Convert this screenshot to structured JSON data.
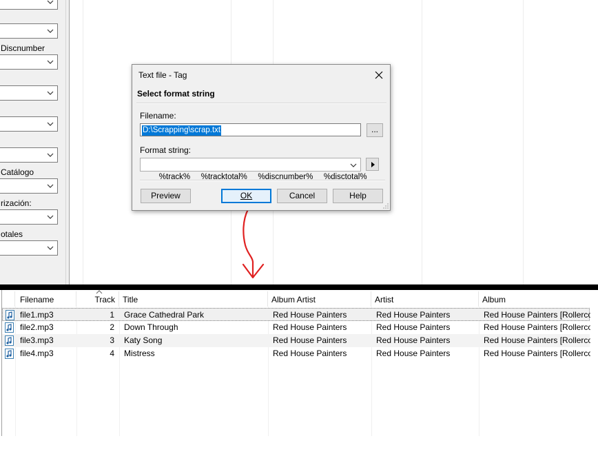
{
  "left_panel": {
    "labels": [
      "Discnumber",
      "Catálogo",
      "rización:",
      "otales"
    ]
  },
  "dialog": {
    "title": "Text file - Tag",
    "subtitle": "Select format string",
    "filename_label": "Filename:",
    "filename_value": "D:\\Scrapping\\scrap.txt",
    "browse_label": "...",
    "format_label": "Format string:",
    "format_value": "%track%   %tracktotal%   %discnumber%   %disctotal%",
    "buttons": {
      "preview": "Preview",
      "ok": "OK",
      "cancel": "Cancel",
      "help": "Help"
    }
  },
  "file_list": {
    "columns": [
      "Filename",
      "Track",
      "Title",
      "Album Artist",
      "Artist",
      "Album"
    ],
    "rows": [
      {
        "filename": "file1.mp3",
        "track": "1",
        "title": "Grace Cathedral Park",
        "album_artist": "Red House Painters",
        "artist": "Red House Painters",
        "album": "Red House Painters [Rollerco..."
      },
      {
        "filename": "file2.mp3",
        "track": "2",
        "title": "Down Through",
        "album_artist": "Red House Painters",
        "artist": "Red House Painters",
        "album": "Red House Painters [Rollerco..."
      },
      {
        "filename": "file3.mp3",
        "track": "3",
        "title": "Katy Song",
        "album_artist": "Red House Painters",
        "artist": "Red House Painters",
        "album": "Red House Painters [Rollerco..."
      },
      {
        "filename": "file4.mp3",
        "track": "4",
        "title": "Mistress",
        "album_artist": "Red House Painters",
        "artist": "Red House Painters",
        "album": "Red House Painters [Rollerco..."
      }
    ]
  },
  "icons": {
    "close": "close-icon",
    "dropdown": "chevron-down-icon",
    "arrow": "chevron-right-icon",
    "file": "audio-file-icon",
    "sort": "sort-up-icon",
    "annotation": "hand-drawn-arrow"
  },
  "colors": {
    "selection": "#0078d7",
    "ok_border": "#0078d7",
    "annotation": "#e02020"
  }
}
